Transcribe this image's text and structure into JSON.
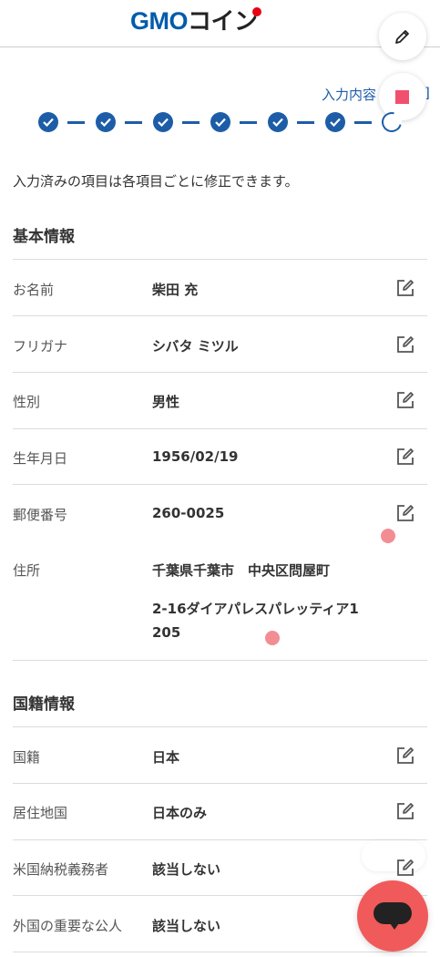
{
  "header": {
    "logo_main": "GMO",
    "logo_sub": "コイン"
  },
  "progress": {
    "label": "入力内容",
    "label_tail": "]",
    "total_steps": 7,
    "completed_steps": 6
  },
  "intro_text": "入力済みの項目は各項目ごとに修正できます。",
  "basic_info": {
    "title": "基本情報",
    "rows": [
      {
        "label": "お名前",
        "value": "柴田 充"
      },
      {
        "label": "フリガナ",
        "value": "シバタ ミツル"
      },
      {
        "label": "性別",
        "value": "男性"
      },
      {
        "label": "生年月日",
        "value": "1956/02/19"
      },
      {
        "label": "郵便番号",
        "value": "260-0025"
      },
      {
        "label": "住所",
        "value_line1": "千葉県千葉市　中央区問屋町",
        "value_line2": "2-16ダイアパレスパレッティア1",
        "value_line3": "205"
      }
    ]
  },
  "nationality_info": {
    "title": "国籍情報",
    "rows": [
      {
        "label": "国籍",
        "value": "日本"
      },
      {
        "label": "居住地国",
        "value": "日本のみ"
      },
      {
        "label": "米国納税義務者",
        "value": "該当しない"
      },
      {
        "label": "外国の重要な公人",
        "value": "該当しない"
      }
    ]
  },
  "colors": {
    "brand_blue": "#1d5da8",
    "accent_red": "#f15a5a",
    "stop_pink": "#f0506e"
  },
  "icons": {
    "edit": "edit-icon",
    "pencil": "pencil-icon",
    "stop": "stop-icon",
    "check": "check-icon",
    "chat": "chat-icon"
  }
}
